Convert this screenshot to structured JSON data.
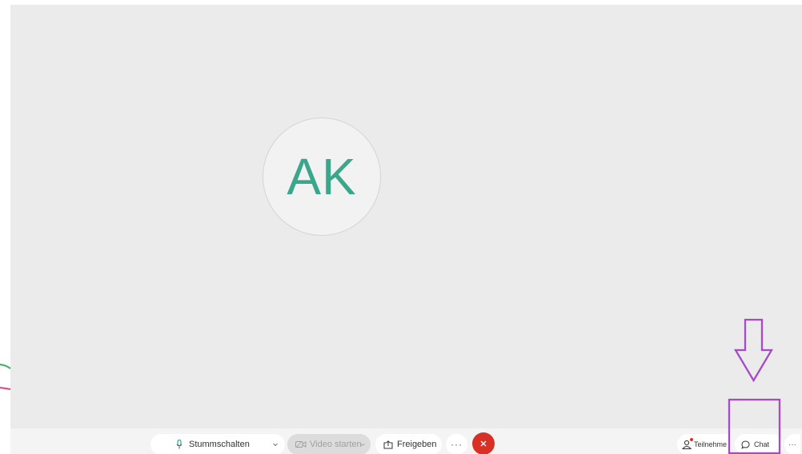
{
  "participant": {
    "initials": "AK"
  },
  "toolbar": {
    "mute_label": "Stummschalten",
    "video_label": "Video starten",
    "share_label": "Freigeben",
    "more_label": "···",
    "participants_label": "Teilnehme",
    "chat_label": "Chat",
    "overflow_label": "···"
  },
  "icons": {
    "mute": "microphone-icon",
    "video": "video-camera-icon",
    "share": "share-icon",
    "end": "close-icon",
    "participants": "person-icon",
    "chat": "speech-bubble-icon"
  },
  "colors": {
    "avatar_text": "#3aa68c",
    "end_call": "#d93025",
    "annotation": "#a64ac9",
    "stroke_green": "#4caf6a",
    "stroke_pink": "#e0408a"
  }
}
